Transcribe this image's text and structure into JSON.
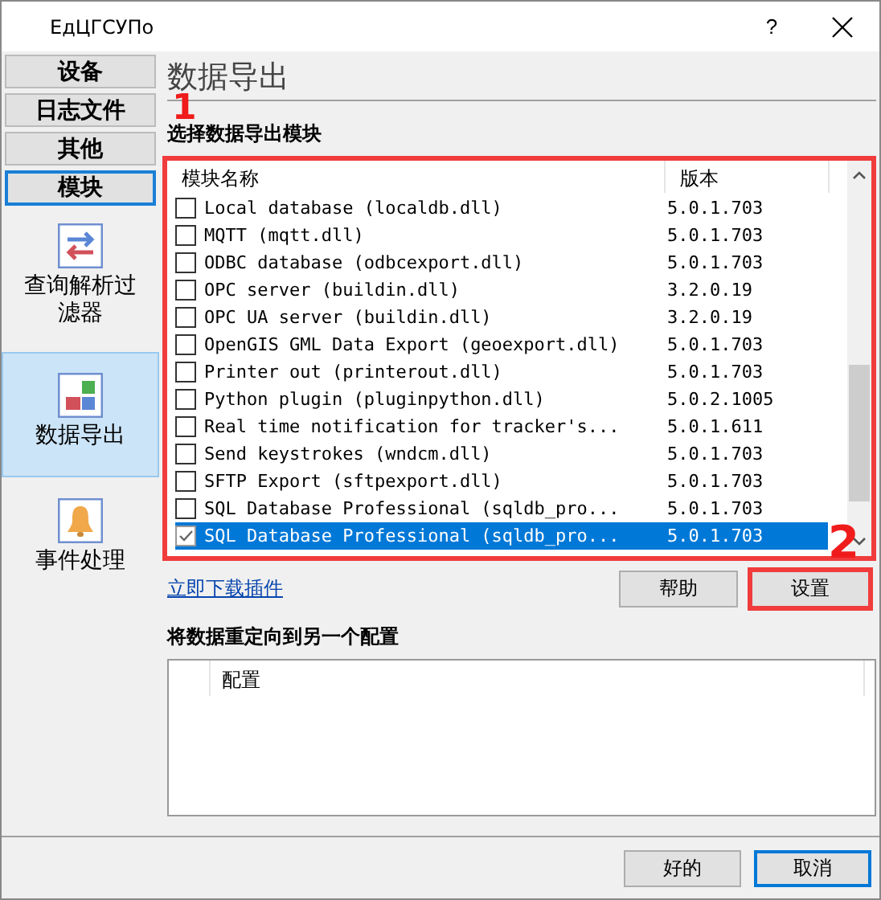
{
  "window": {
    "title": "ЕдЦГСУПо",
    "help": "?"
  },
  "sidebar": {
    "tabs": [
      {
        "label": "设备",
        "selected": false
      },
      {
        "label": "日志文件",
        "selected": false
      },
      {
        "label": "其他",
        "selected": false
      },
      {
        "label": "模块",
        "selected": true
      }
    ],
    "items": [
      {
        "label": "查询解析过滤器",
        "kind": "filter",
        "selected": false
      },
      {
        "label": "数据导出",
        "kind": "export",
        "selected": true
      },
      {
        "label": "事件处理",
        "kind": "event",
        "selected": false
      }
    ]
  },
  "page": {
    "title": "数据导出",
    "section": "选择数据导出模块",
    "modules": {
      "highlighted": true,
      "columns": [
        "模块名称",
        "版本"
      ],
      "rows": [
        {
          "name": "Local database (localdb.dll)",
          "version": "5.0.1.703",
          "checked": false,
          "selected": false
        },
        {
          "name": "MQTT (mqtt.dll)",
          "version": "5.0.1.703",
          "checked": false,
          "selected": false
        },
        {
          "name": "ODBC database (odbcexport.dll)",
          "version": "5.0.1.703",
          "checked": false,
          "selected": false
        },
        {
          "name": "OPC server (buildin.dll)",
          "version": "3.2.0.19",
          "checked": false,
          "selected": false
        },
        {
          "name": "OPC UA server (buildin.dll)",
          "version": "3.2.0.19",
          "checked": false,
          "selected": false
        },
        {
          "name": "OpenGIS GML Data Export (geoexport.dll)",
          "version": "5.0.1.703",
          "checked": false,
          "selected": false
        },
        {
          "name": "Printer out (printerout.dll)",
          "version": "5.0.1.703",
          "checked": false,
          "selected": false
        },
        {
          "name": "Python plugin (pluginpython.dll)",
          "version": "5.0.2.1005",
          "checked": false,
          "selected": false
        },
        {
          "name": "Real time notification for tracker's...",
          "version": "5.0.1.611",
          "checked": false,
          "selected": false
        },
        {
          "name": "Send keystrokes (wndcm.dll)",
          "version": "5.0.1.703",
          "checked": false,
          "selected": false
        },
        {
          "name": "SFTP Export (sftpexport.dll)",
          "version": "5.0.1.703",
          "checked": false,
          "selected": false
        },
        {
          "name": "SQL Database Professional (sqldb_pro...",
          "version": "5.0.1.703",
          "checked": false,
          "selected": false
        },
        {
          "name": "SQL Database Professional (sqldb_pro...",
          "version": "5.0.1.703",
          "checked": true,
          "selected": true
        }
      ]
    },
    "link": "立即下载插件",
    "buttons": [
      {
        "label": "帮助",
        "highlighted": false
      },
      {
        "label": "设置",
        "highlighted": true
      }
    ],
    "redirect": {
      "title": "将数据重定向到另一个配置",
      "columns": [
        "配置"
      ]
    },
    "annotations": [
      {
        "label": "1"
      },
      {
        "label": "2"
      }
    ]
  },
  "footer": {
    "buttons": [
      {
        "label": "好的",
        "default": false
      },
      {
        "label": "取消",
        "default": true
      }
    ]
  }
}
